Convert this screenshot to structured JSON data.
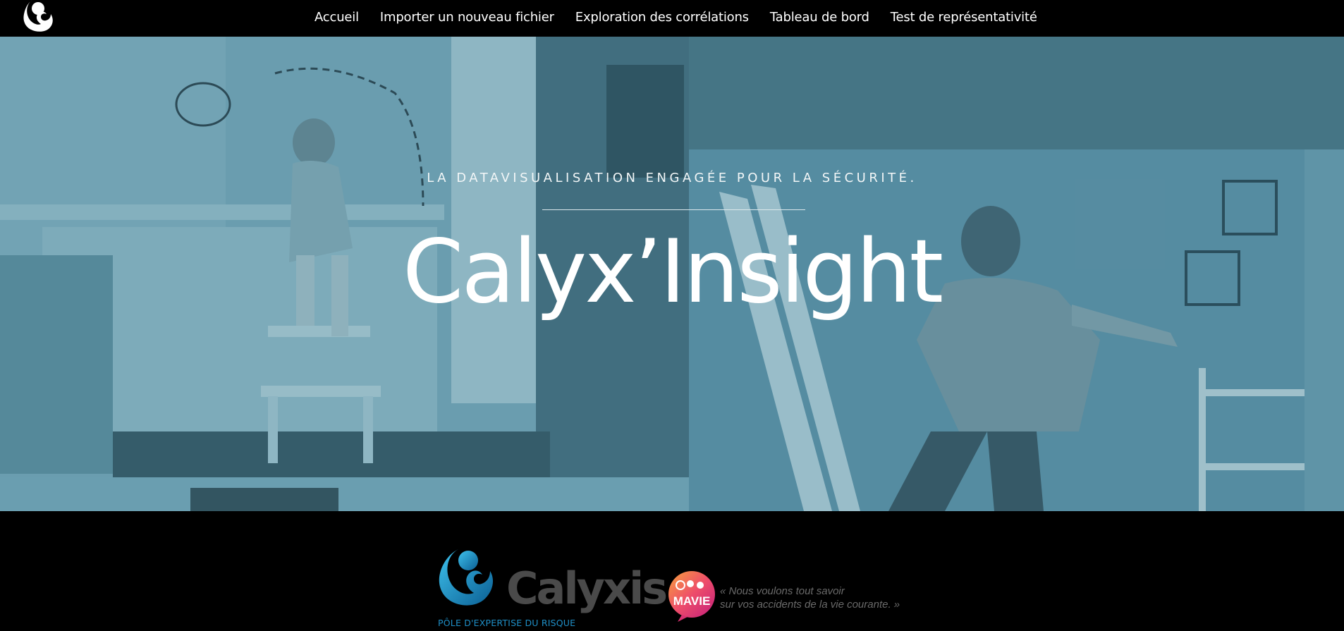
{
  "nav": {
    "logo_icon": "calyxis-white-logo-icon",
    "items": [
      {
        "label": "Accueil"
      },
      {
        "label": "Importer un nouveau fichier"
      },
      {
        "label": "Exploration des corrélations"
      },
      {
        "label": "Tableau de bord"
      },
      {
        "label": "Test de représentativité"
      }
    ]
  },
  "hero": {
    "tagline": "LA DATAVISUALISATION ENGAGÉE POUR LA SÉCURITÉ.",
    "title": "Calyx’Insight",
    "overlay_color": "#5a8c9e",
    "background_description_icon": "hero-photo-collage"
  },
  "footer": {
    "calyxis": {
      "name": "Calyxis",
      "subtitle": "PÔLE D'EXPERTISE DU RISQUE",
      "brand_color": "#1f8fc7"
    },
    "mavie": {
      "name": "MAVIE",
      "line1": "« Nous voulons tout savoir",
      "line2": "sur vos accidents de la vie courante. »"
    }
  }
}
